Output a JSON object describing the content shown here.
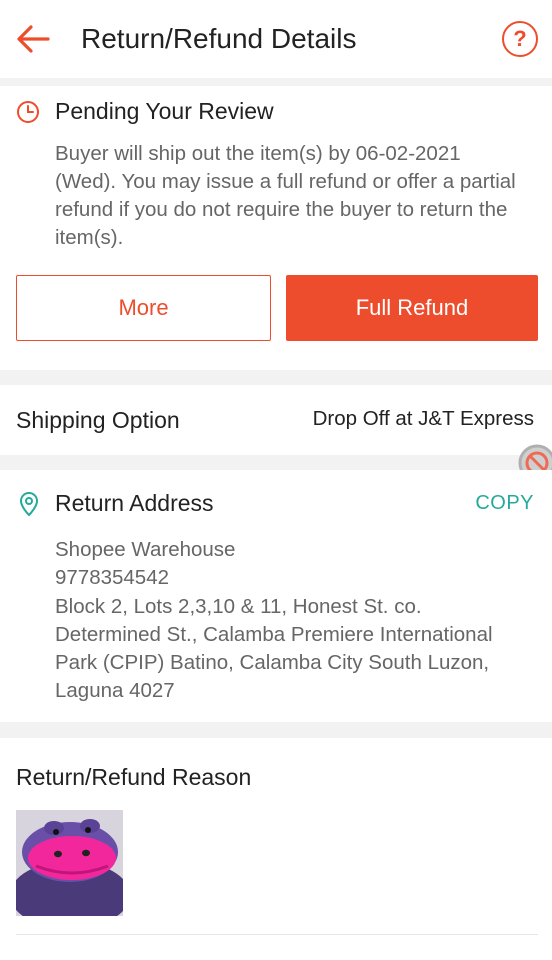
{
  "header": {
    "title": "Return/Refund Details",
    "help_symbol": "?",
    "back_icon": "arrow-left-icon",
    "accent": "#ee4d2d"
  },
  "status": {
    "icon": "clock-icon",
    "title": "Pending Your Review",
    "description": "Buyer will ship out the item(s) by 06-02-2021 (Wed). You may issue a full refund or offer a partial refund if you do not require the buyer to return the item(s).",
    "more_label": "More",
    "full_refund_label": "Full Refund"
  },
  "shipping": {
    "label": "Shipping Option",
    "value": "Drop Off at J&T Express"
  },
  "address": {
    "icon": "location-pin-icon",
    "title": "Return Address",
    "copy_label": "COPY",
    "copy_color": "#26aa99",
    "lines": [
      "Shopee Warehouse",
      "9778354542",
      "Block 2, Lots 2,3,10 & 11, Honest St. co.",
      "Determined St., Calamba Premiere International",
      "Park (CPIP) Batino, Calamba City South Luzon,",
      "Laguna 4027"
    ]
  },
  "reason": {
    "title": "Return/Refund Reason",
    "photo": "product-photo"
  }
}
